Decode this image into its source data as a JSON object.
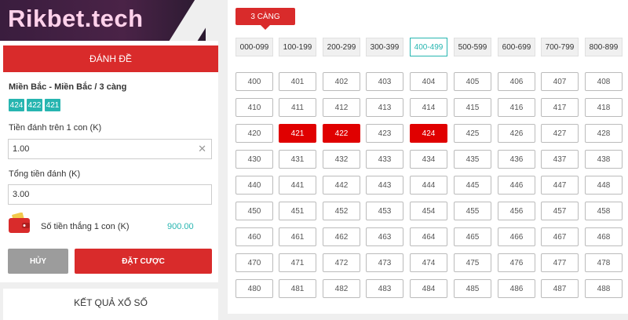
{
  "brand": {
    "logo_text": "Rikbet.tech"
  },
  "bet_panel": {
    "header": "ĐÁNH ĐỀ",
    "selection_title": "Miền Bắc - Miền Bắc / 3 càng",
    "chips": [
      "424",
      "422",
      "421"
    ],
    "stake_label": "Tiền đánh trên 1 con (K)",
    "stake_value": "1.00",
    "total_label": "Tổng tiền đánh (K)",
    "total_value": "3.00",
    "win_label": "Số tiền thắng 1 con (K)",
    "win_value": "900.00",
    "cancel_label": "HỦY",
    "bet_label": "ĐẶT CƯỢC"
  },
  "results": {
    "title": "KẾT QUẢ XỔ SỐ"
  },
  "board": {
    "tab_label": "3 CÀNG",
    "ranges": [
      "000-099",
      "100-199",
      "200-299",
      "300-399",
      "400-499",
      "500-599",
      "600-699",
      "700-799",
      "800-899"
    ],
    "active_range": "400-499",
    "numbers": [
      [
        "400",
        "401",
        "402",
        "403",
        "404",
        "405",
        "406",
        "407",
        "408"
      ],
      [
        "410",
        "411",
        "412",
        "413",
        "414",
        "415",
        "416",
        "417",
        "418"
      ],
      [
        "420",
        "421",
        "422",
        "423",
        "424",
        "425",
        "426",
        "427",
        "428"
      ],
      [
        "430",
        "431",
        "432",
        "433",
        "434",
        "435",
        "436",
        "437",
        "438"
      ],
      [
        "440",
        "441",
        "442",
        "443",
        "444",
        "445",
        "446",
        "447",
        "448"
      ],
      [
        "450",
        "451",
        "452",
        "453",
        "454",
        "455",
        "456",
        "457",
        "458"
      ],
      [
        "460",
        "461",
        "462",
        "463",
        "464",
        "465",
        "466",
        "467",
        "468"
      ],
      [
        "470",
        "471",
        "472",
        "473",
        "474",
        "475",
        "476",
        "477",
        "478"
      ],
      [
        "480",
        "481",
        "482",
        "483",
        "484",
        "485",
        "486",
        "487",
        "488"
      ]
    ],
    "selected": [
      "421",
      "422",
      "424"
    ]
  }
}
